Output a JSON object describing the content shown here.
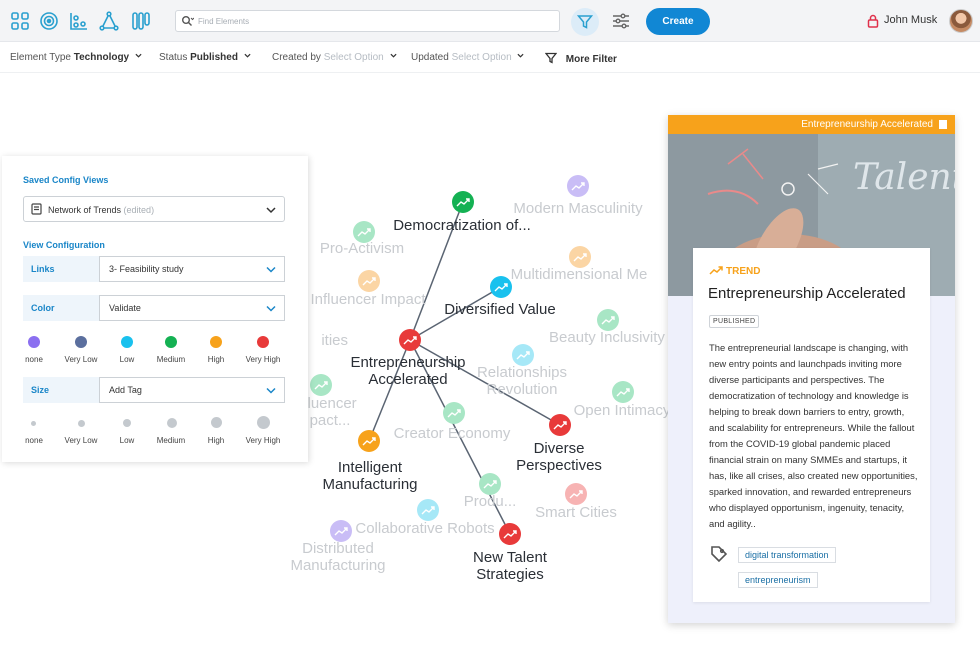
{
  "topbar": {
    "nav_icons": [
      "grid-icon",
      "target-icon",
      "scatter-icon",
      "network-icon",
      "columns-icon"
    ],
    "search_placeholder": "Find Elements",
    "create_label": "Create",
    "user_name": "John Musk"
  },
  "filters": {
    "element_type_label": "Element Type",
    "element_type_value": "Technology",
    "status_label": "Status",
    "status_value": "Published",
    "created_by_label": "Created by",
    "created_by_placeholder": "Select Option",
    "updated_label": "Updated",
    "updated_placeholder": "Select Option",
    "more_filter_label": "More Filter"
  },
  "config": {
    "saved_views_title": "Saved Config Views",
    "saved_view_value": "Network of Trends",
    "saved_view_suffix": "(edited)",
    "view_config_title": "View Configuration",
    "links_label": "Links",
    "links_value": "3- Feasibility study",
    "color_label": "Color",
    "color_value": "Validate",
    "size_label": "Size",
    "size_value": "Add Tag",
    "color_legend": [
      {
        "label": "none",
        "color": "#8b6ff0"
      },
      {
        "label": "Very Low",
        "color": "#5b6f9e"
      },
      {
        "label": "Low",
        "color": "#19c1ee"
      },
      {
        "label": "Medium",
        "color": "#14b153"
      },
      {
        "label": "High",
        "color": "#f7a21b"
      },
      {
        "label": "Very High",
        "color": "#e83a3a"
      }
    ],
    "size_legend": [
      "none",
      "Very Low",
      "Low",
      "Medium",
      "High",
      "Very High"
    ]
  },
  "graph": {
    "nodes": [
      {
        "label": "Democratization of...",
        "color": "#14b153"
      },
      {
        "label": "Diversified Value",
        "color": "#19c1ee"
      },
      {
        "label": "Entrepreneurship Accelerated",
        "color": "#e83a3a"
      },
      {
        "label": "Intelligent Manufacturing",
        "color": "#f7a21b"
      },
      {
        "label": "Diverse Perspectives",
        "color": "#e83a3a"
      },
      {
        "label": "New Talent Strategies",
        "color": "#e83a3a"
      },
      {
        "label": "Modern Masculinity",
        "color": "#c9bdf6"
      },
      {
        "label": "Pro-Activism",
        "color": "#a8e6c5"
      },
      {
        "label": "Multidimensional Me",
        "color": "#fbd5a4"
      },
      {
        "label": "Influencer Impact",
        "color": "#fbd5a4"
      },
      {
        "label": "Beauty Inclusivity",
        "color": "#a8e6c5"
      },
      {
        "label": "ities",
        "color": "#ffffff"
      },
      {
        "label": "Relationships Revolution",
        "color": "#a6e8f7"
      },
      {
        "label": "Open Intimacy",
        "color": "#a8e6c5"
      },
      {
        "label": "fluencer pact...",
        "color": "#a8e6c5"
      },
      {
        "label": "Creator Economy",
        "color": "#a8e6c5"
      },
      {
        "label": "Produ...",
        "color": "#a8e6c5"
      },
      {
        "label": "Smart Cities",
        "color": "#f7b3b3"
      },
      {
        "label": "Collaborative Robots",
        "color": "#a6e8f7"
      },
      {
        "label": "Distributed Manufacturing",
        "color": "#c9bdf6"
      }
    ]
  },
  "card": {
    "strip_label": "Entrepreneurship  Accelerated",
    "type_label": "TREND",
    "title": "Entrepreneurship Accelerated",
    "status_badge": "PUBLISHED",
    "description": "The entrepreneurial landscape is changing, with new entry points and launchpads inviting more diverse participants and perspectives. The democratization of technology and knowledge is helping to break down barriers to entry, growth, and scalability for entrepreneurs. While the fallout from the COVID-19 global pandemic placed financial strain on many SMMEs and startups, it has, like all crises, also created new opportunities, sparked innovation, and rewarded entrepreneurs who displayed opportunism, ingenuity, tenacity, and agility..",
    "tags": [
      "digital transformation",
      "entrepreneurism"
    ],
    "image_text": "Talent"
  }
}
